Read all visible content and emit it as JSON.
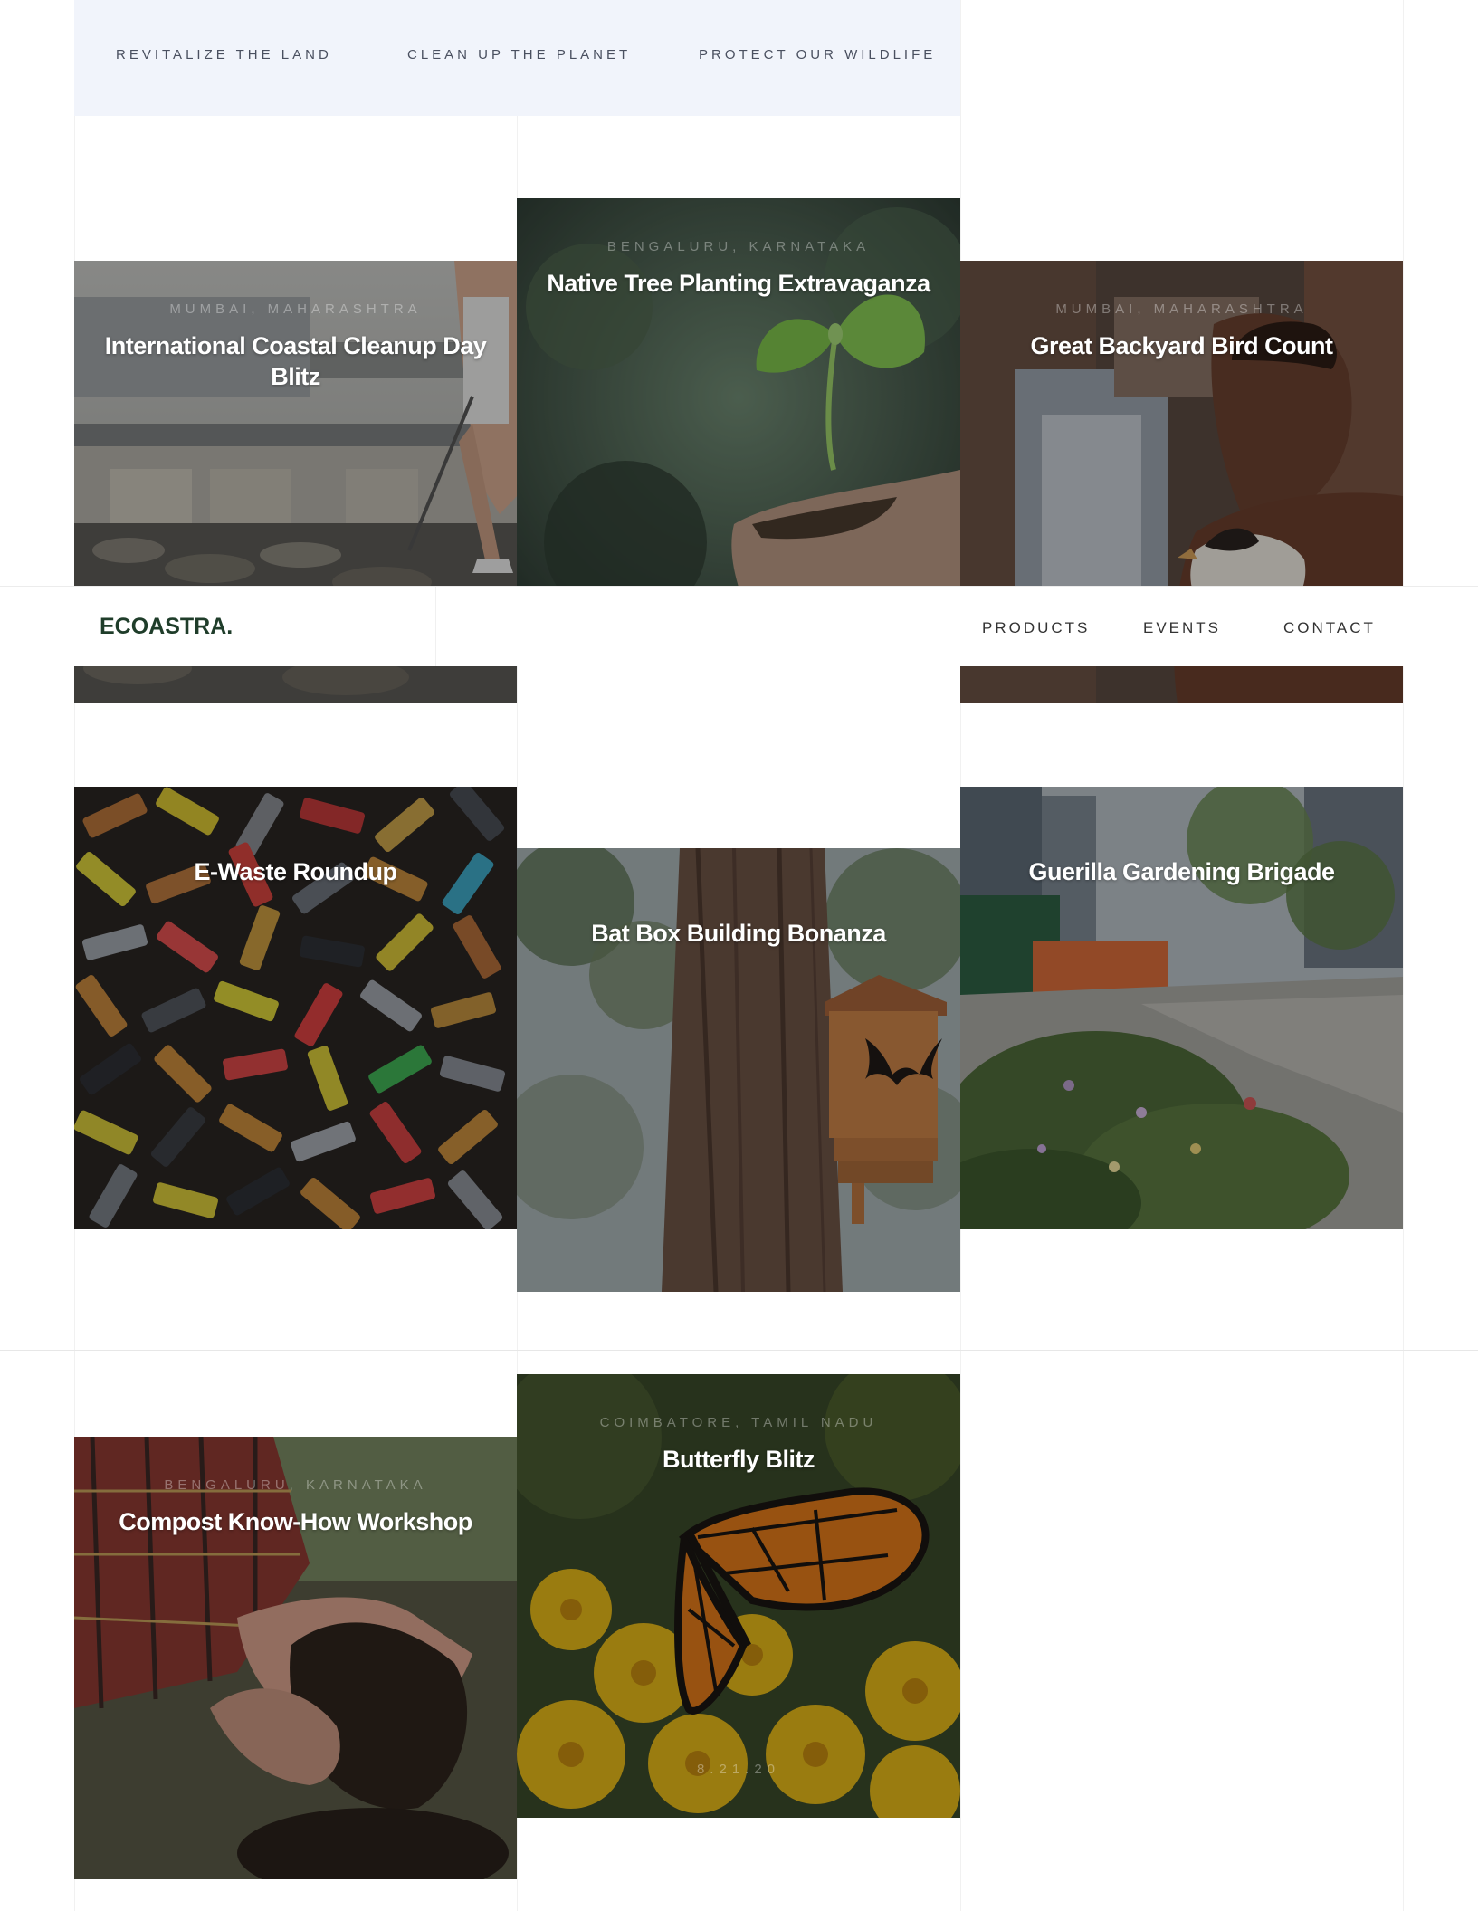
{
  "categories": [
    "REVITALIZE THE LAND",
    "CLEAN UP THE PLANET",
    "PROTECT OUR WILDLIFE"
  ],
  "brand": {
    "logo": "ECOASTRA."
  },
  "nav": {
    "items": [
      "PRODUCTS",
      "EVENTS",
      "CONTACT"
    ]
  },
  "events": [
    {
      "title": "International Coastal Cleanup Day Blitz",
      "location": "MUMBAI, MAHARASHTRA",
      "image": "coastal-cleanup-photo"
    },
    {
      "title": "Native Tree Planting Extravaganza",
      "location": "BENGALURU, KARNATAKA",
      "image": "seedling-photo"
    },
    {
      "title": "Great Backyard Bird Count",
      "location": "MUMBAI, MAHARASHTRA",
      "image": "bird-photo"
    },
    {
      "title": "E-Waste Roundup",
      "location": "",
      "image": "batteries-photo"
    },
    {
      "title": "Bat Box Building Bonanza",
      "location": "",
      "image": "bat-box-photo"
    },
    {
      "title": "Guerilla Gardening Brigade",
      "location": "",
      "image": "street-garden-photo"
    },
    {
      "title": "Compost Know-How Workshop",
      "location": "BENGALURU, KARNATAKA",
      "image": "compost-photo"
    },
    {
      "title": "Butterfly Blitz",
      "location": "COIMBATORE, TAMIL NADU",
      "image": "butterfly-photo",
      "date": "8.21.20"
    }
  ],
  "colors": {
    "category_bar": "#f1f4fb",
    "logo": "#1f3d2a",
    "title": "#ffffff"
  }
}
